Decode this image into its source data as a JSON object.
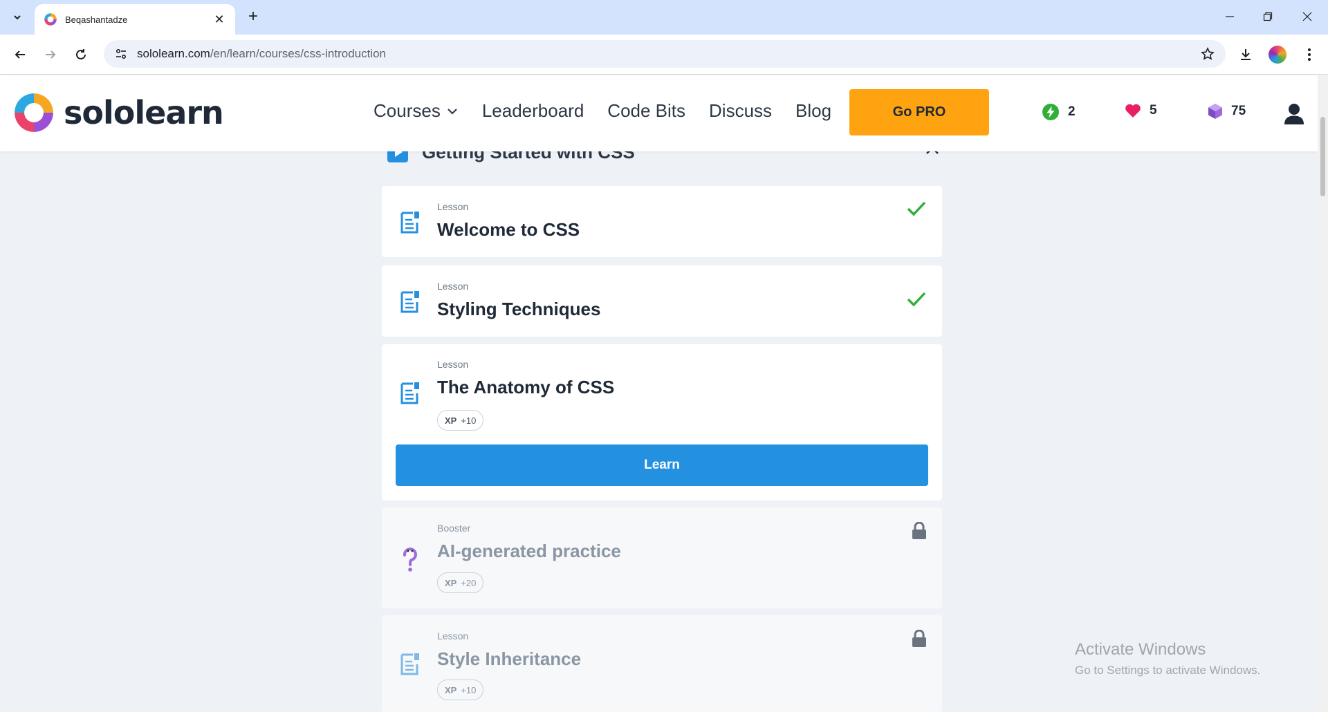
{
  "browser": {
    "tab_title": "Beqashantadze",
    "url_host": "sololearn.com",
    "url_path": "/en/learn/courses/css-introduction"
  },
  "site": {
    "logo_text": "sololearn",
    "nav": {
      "courses": "Courses",
      "leaderboard": "Leaderboard",
      "code_bits": "Code Bits",
      "discuss": "Discuss",
      "blog": "Blog"
    },
    "go_pro": "Go PRO",
    "stats": {
      "streak": "2",
      "hearts": "5",
      "gems": "75"
    },
    "colors": {
      "pro": "#ffa310",
      "primary": "#2490e0",
      "check": "#2fae38"
    }
  },
  "module": {
    "title": "Getting Started with CSS",
    "items": [
      {
        "kind": "Lesson",
        "title": "Welcome to CSS",
        "status": "completed"
      },
      {
        "kind": "Lesson",
        "title": "Styling Techniques",
        "status": "completed"
      },
      {
        "kind": "Lesson",
        "title": "The Anatomy of CSS",
        "status": "current",
        "xp_label": "XP",
        "xp_value": "+10",
        "action": "Learn"
      },
      {
        "kind": "Booster",
        "title": "AI-generated practice",
        "status": "locked",
        "xp_label": "XP",
        "xp_value": "+20"
      },
      {
        "kind": "Lesson",
        "title": "Style Inheritance",
        "status": "locked",
        "xp_label": "XP",
        "xp_value": "+10"
      }
    ]
  },
  "watermark": {
    "line1": "Activate Windows",
    "line2": "Go to Settings to activate Windows."
  }
}
